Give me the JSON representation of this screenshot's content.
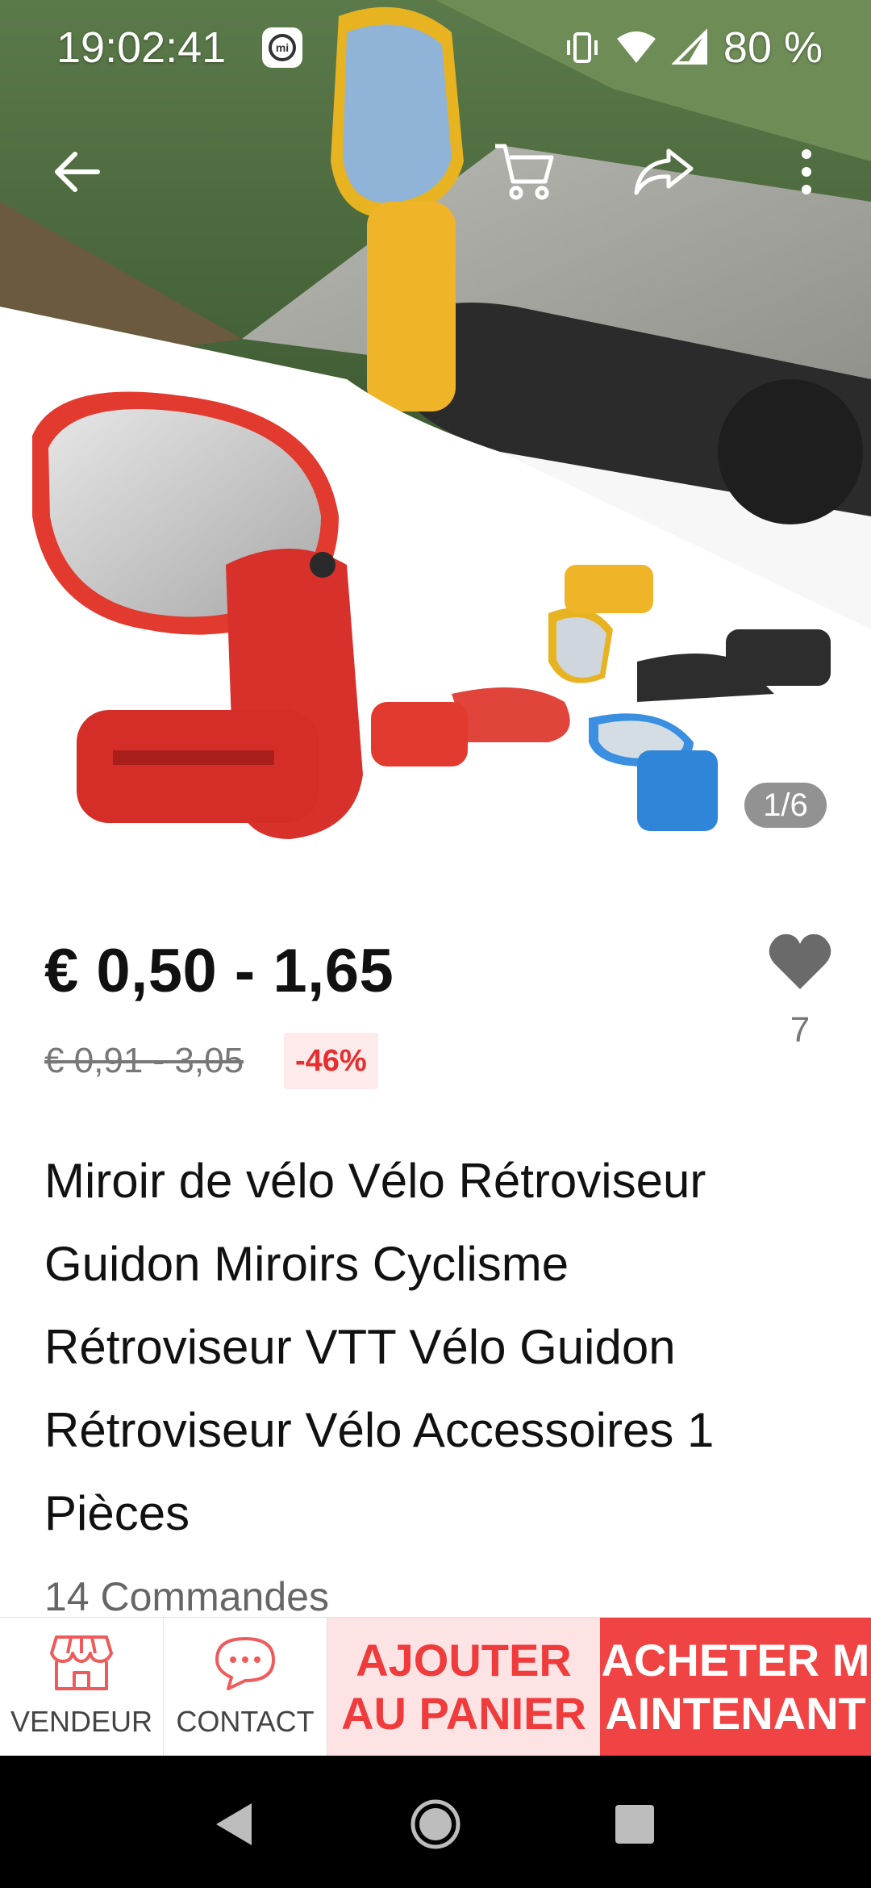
{
  "status": {
    "time": "19:02:41",
    "battery": "80 %",
    "icons": [
      "mi-app-icon",
      "vibrate-icon",
      "wifi-icon",
      "signal-icon"
    ]
  },
  "nav": {
    "back": "arrow-left-icon",
    "cart": "cart-icon",
    "share": "share-icon",
    "more": "more-vertical-icon"
  },
  "gallery": {
    "counter": "1/6"
  },
  "product": {
    "price": "€ 0,50 - 1,65",
    "old_price": "€ 0,91 - 3,05",
    "discount": "-46%",
    "wishlist_count": "7",
    "title": "Miroir de vélo Vélo Rétroviseur Guidon Miroirs Cyclisme Rétroviseur VTT Vélo Guidon Rétroviseur Vélo Accessoires 1 Pièces",
    "orders": "14 Commandes"
  },
  "actions": {
    "store_label": "VENDEUR",
    "contact_label": "CONTACT",
    "add_to_cart_line1": "AJOUTER",
    "add_to_cart_line2": "AU PANIER",
    "buy_now_line1": "ACHETER M",
    "buy_now_line2": "AINTENANT"
  },
  "colors": {
    "accent": "#f04343",
    "cart_bg": "#fde3e3",
    "discount_text": "#e62e2e"
  }
}
